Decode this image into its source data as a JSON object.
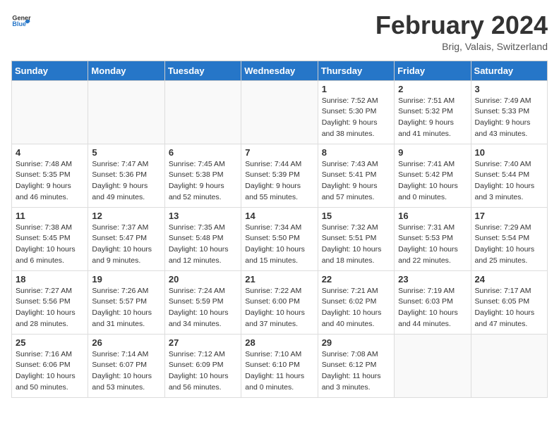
{
  "header": {
    "logo_general": "General",
    "logo_blue": "Blue",
    "title": "February 2024",
    "location": "Brig, Valais, Switzerland"
  },
  "days_of_week": [
    "Sunday",
    "Monday",
    "Tuesday",
    "Wednesday",
    "Thursday",
    "Friday",
    "Saturday"
  ],
  "weeks": [
    [
      {
        "day": "",
        "sunrise": "",
        "sunset": "",
        "daylight": ""
      },
      {
        "day": "",
        "sunrise": "",
        "sunset": "",
        "daylight": ""
      },
      {
        "day": "",
        "sunrise": "",
        "sunset": "",
        "daylight": ""
      },
      {
        "day": "",
        "sunrise": "",
        "sunset": "",
        "daylight": ""
      },
      {
        "day": "1",
        "sunrise": "Sunrise: 7:52 AM",
        "sunset": "Sunset: 5:30 PM",
        "daylight": "Daylight: 9 hours and 38 minutes."
      },
      {
        "day": "2",
        "sunrise": "Sunrise: 7:51 AM",
        "sunset": "Sunset: 5:32 PM",
        "daylight": "Daylight: 9 hours and 41 minutes."
      },
      {
        "day": "3",
        "sunrise": "Sunrise: 7:49 AM",
        "sunset": "Sunset: 5:33 PM",
        "daylight": "Daylight: 9 hours and 43 minutes."
      }
    ],
    [
      {
        "day": "4",
        "sunrise": "Sunrise: 7:48 AM",
        "sunset": "Sunset: 5:35 PM",
        "daylight": "Daylight: 9 hours and 46 minutes."
      },
      {
        "day": "5",
        "sunrise": "Sunrise: 7:47 AM",
        "sunset": "Sunset: 5:36 PM",
        "daylight": "Daylight: 9 hours and 49 minutes."
      },
      {
        "day": "6",
        "sunrise": "Sunrise: 7:45 AM",
        "sunset": "Sunset: 5:38 PM",
        "daylight": "Daylight: 9 hours and 52 minutes."
      },
      {
        "day": "7",
        "sunrise": "Sunrise: 7:44 AM",
        "sunset": "Sunset: 5:39 PM",
        "daylight": "Daylight: 9 hours and 55 minutes."
      },
      {
        "day": "8",
        "sunrise": "Sunrise: 7:43 AM",
        "sunset": "Sunset: 5:41 PM",
        "daylight": "Daylight: 9 hours and 57 minutes."
      },
      {
        "day": "9",
        "sunrise": "Sunrise: 7:41 AM",
        "sunset": "Sunset: 5:42 PM",
        "daylight": "Daylight: 10 hours and 0 minutes."
      },
      {
        "day": "10",
        "sunrise": "Sunrise: 7:40 AM",
        "sunset": "Sunset: 5:44 PM",
        "daylight": "Daylight: 10 hours and 3 minutes."
      }
    ],
    [
      {
        "day": "11",
        "sunrise": "Sunrise: 7:38 AM",
        "sunset": "Sunset: 5:45 PM",
        "daylight": "Daylight: 10 hours and 6 minutes."
      },
      {
        "day": "12",
        "sunrise": "Sunrise: 7:37 AM",
        "sunset": "Sunset: 5:47 PM",
        "daylight": "Daylight: 10 hours and 9 minutes."
      },
      {
        "day": "13",
        "sunrise": "Sunrise: 7:35 AM",
        "sunset": "Sunset: 5:48 PM",
        "daylight": "Daylight: 10 hours and 12 minutes."
      },
      {
        "day": "14",
        "sunrise": "Sunrise: 7:34 AM",
        "sunset": "Sunset: 5:50 PM",
        "daylight": "Daylight: 10 hours and 15 minutes."
      },
      {
        "day": "15",
        "sunrise": "Sunrise: 7:32 AM",
        "sunset": "Sunset: 5:51 PM",
        "daylight": "Daylight: 10 hours and 18 minutes."
      },
      {
        "day": "16",
        "sunrise": "Sunrise: 7:31 AM",
        "sunset": "Sunset: 5:53 PM",
        "daylight": "Daylight: 10 hours and 22 minutes."
      },
      {
        "day": "17",
        "sunrise": "Sunrise: 7:29 AM",
        "sunset": "Sunset: 5:54 PM",
        "daylight": "Daylight: 10 hours and 25 minutes."
      }
    ],
    [
      {
        "day": "18",
        "sunrise": "Sunrise: 7:27 AM",
        "sunset": "Sunset: 5:56 PM",
        "daylight": "Daylight: 10 hours and 28 minutes."
      },
      {
        "day": "19",
        "sunrise": "Sunrise: 7:26 AM",
        "sunset": "Sunset: 5:57 PM",
        "daylight": "Daylight: 10 hours and 31 minutes."
      },
      {
        "day": "20",
        "sunrise": "Sunrise: 7:24 AM",
        "sunset": "Sunset: 5:59 PM",
        "daylight": "Daylight: 10 hours and 34 minutes."
      },
      {
        "day": "21",
        "sunrise": "Sunrise: 7:22 AM",
        "sunset": "Sunset: 6:00 PM",
        "daylight": "Daylight: 10 hours and 37 minutes."
      },
      {
        "day": "22",
        "sunrise": "Sunrise: 7:21 AM",
        "sunset": "Sunset: 6:02 PM",
        "daylight": "Daylight: 10 hours and 40 minutes."
      },
      {
        "day": "23",
        "sunrise": "Sunrise: 7:19 AM",
        "sunset": "Sunset: 6:03 PM",
        "daylight": "Daylight: 10 hours and 44 minutes."
      },
      {
        "day": "24",
        "sunrise": "Sunrise: 7:17 AM",
        "sunset": "Sunset: 6:05 PM",
        "daylight": "Daylight: 10 hours and 47 minutes."
      }
    ],
    [
      {
        "day": "25",
        "sunrise": "Sunrise: 7:16 AM",
        "sunset": "Sunset: 6:06 PM",
        "daylight": "Daylight: 10 hours and 50 minutes."
      },
      {
        "day": "26",
        "sunrise": "Sunrise: 7:14 AM",
        "sunset": "Sunset: 6:07 PM",
        "daylight": "Daylight: 10 hours and 53 minutes."
      },
      {
        "day": "27",
        "sunrise": "Sunrise: 7:12 AM",
        "sunset": "Sunset: 6:09 PM",
        "daylight": "Daylight: 10 hours and 56 minutes."
      },
      {
        "day": "28",
        "sunrise": "Sunrise: 7:10 AM",
        "sunset": "Sunset: 6:10 PM",
        "daylight": "Daylight: 11 hours and 0 minutes."
      },
      {
        "day": "29",
        "sunrise": "Sunrise: 7:08 AM",
        "sunset": "Sunset: 6:12 PM",
        "daylight": "Daylight: 11 hours and 3 minutes."
      },
      {
        "day": "",
        "sunrise": "",
        "sunset": "",
        "daylight": ""
      },
      {
        "day": "",
        "sunrise": "",
        "sunset": "",
        "daylight": ""
      }
    ]
  ]
}
